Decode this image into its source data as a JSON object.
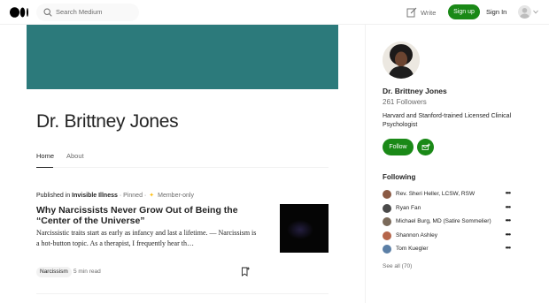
{
  "topbar": {
    "search_placeholder": "Search Medium",
    "write_label": "Write",
    "signup_label": "Sign up",
    "signin_label": "Sign In"
  },
  "profile": {
    "name": "Dr. Brittney Jones",
    "followers": "261 Followers",
    "bio": "Harvard and Stanford-trained Licensed Clinical Psychologist",
    "follow_label": "Follow"
  },
  "tabs": [
    {
      "label": "Home",
      "active": true
    },
    {
      "label": "About",
      "active": false
    }
  ],
  "post": {
    "published_in_label": "Published in",
    "publication": "Invisible Illness",
    "pinned": "· Pinned ·",
    "member": "Member-only",
    "title": "Why Narcissists Never Grow Out of Being the “Center of the Universe”",
    "excerpt": "Narcissistic traits start as early as infancy and last a lifetime. — Narcissism is a hot-button topic. As a therapist, I frequently hear th…",
    "tag": "Narcissism",
    "read_time": "5 min read"
  },
  "following": {
    "heading": "Following",
    "items": [
      {
        "name": "Rev. Sheri Heller, LCSW, RSW",
        "color": "#8a5a44"
      },
      {
        "name": "Ryan Fan",
        "color": "#4a4a4a"
      },
      {
        "name": "Michael Burg, MD (Satire Sommelier)",
        "color": "#7a6a5a"
      },
      {
        "name": "Shannon Ashley",
        "color": "#b5654a"
      },
      {
        "name": "Tom Kuegler",
        "color": "#5b7fa6"
      }
    ],
    "see_all": "See all (70)"
  },
  "colors": {
    "accent_green": "#1a8917",
    "banner": "#2c7a7b"
  }
}
